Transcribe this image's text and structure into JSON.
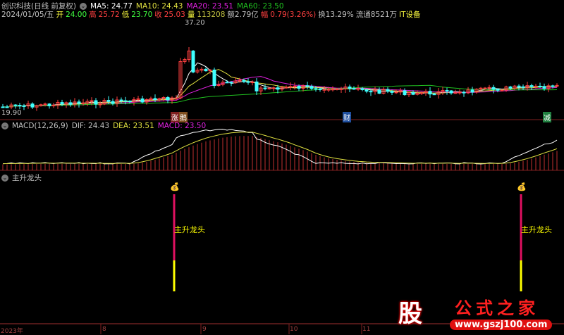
{
  "header": {
    "title": "创识科技(日线 前复权)",
    "ma5": "MA5: 24.77",
    "ma10": "MA10: 24.43",
    "ma20": "MA20: 23.51",
    "ma60": "MA60: 23.50"
  },
  "quote": {
    "date": "2024/01/05/五",
    "open_l": "开",
    "open": "24.00",
    "high_l": "高",
    "high": "25.72",
    "low_l": "低",
    "low": "23.70",
    "close_l": "收",
    "close": "25.03",
    "vol_l": "量",
    "vol": "113208",
    "amt": "额2.79亿",
    "chg_l": "幅",
    "chg": "0.79(3.26%)",
    "turn": "换13.29%",
    "float": "流通8521万",
    "sector": "IT设备"
  },
  "chart": {
    "high_label": "37.20",
    "low_label": "19.90",
    "tags": [
      "涨",
      "鹅",
      "财",
      "减"
    ]
  },
  "macd": {
    "title": "MACD(12,26,9)",
    "dif": "DIF: 24.43",
    "dea": "DEA: 23.51",
    "macd": "MACD: 23.50"
  },
  "indicator": {
    "title": "主升龙头",
    "signal_label": "主升龙头"
  },
  "axis": {
    "labels": [
      "2023年",
      "8",
      "9",
      "10",
      "11"
    ]
  },
  "watermark": {
    "logo": "股",
    "name": "公式之家",
    "url": "www.gszj100.com"
  },
  "colors": {
    "ma5": "#ffffff",
    "ma10": "#e0e040",
    "ma20": "#e020e0",
    "ma60": "#20c020",
    "up": "#ff4040",
    "down": "#40ffff"
  }
}
